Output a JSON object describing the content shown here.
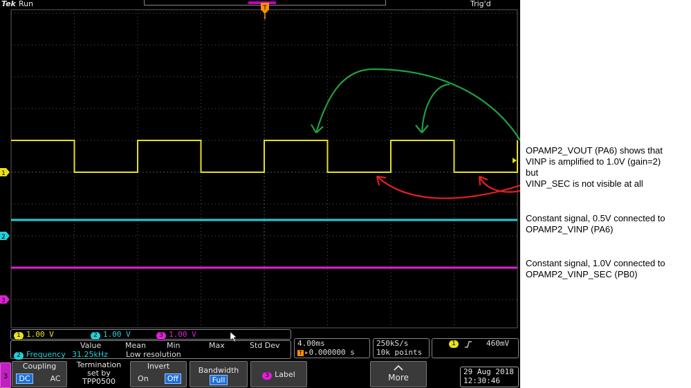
{
  "topbar": {
    "logo": "Tek",
    "run_state": "Run",
    "trigger_state": "Trig'd"
  },
  "colors": {
    "ch1": "#e8e020",
    "ch2": "#20d0d8",
    "ch3": "#e020d8",
    "arrow_green": "#20a040",
    "arrow_red": "#e02020",
    "grid": "#5a5a5a",
    "accent_blue": "#1e6fd6",
    "trigger_marker": "#ff9000"
  },
  "channels": [
    {
      "number": "1",
      "scale": "1.00 V"
    },
    {
      "number": "2",
      "scale": "1.00 V"
    },
    {
      "number": "3",
      "scale": "1.00 V"
    }
  ],
  "traces": {
    "ch1": {
      "shape": "square",
      "high_div": 1.0,
      "low_div": 0.0,
      "period_div": 2.0,
      "start_high": true,
      "edges_div": [
        1.0,
        2.0,
        3.0,
        4.0,
        5.0,
        6.0,
        7.0,
        8.0
      ]
    },
    "ch2": {
      "shape": "dc",
      "level_div": -1.5
    },
    "ch3": {
      "shape": "dc",
      "level_div": -3.0
    }
  },
  "measurement": {
    "headers": [
      "Value",
      "Mean",
      "Min",
      "Max",
      "Std Dev"
    ],
    "channel": "2",
    "name": "Frequency",
    "value": "31.25kHz",
    "note": "Low resolution"
  },
  "timebase": {
    "scale": "4.00ms",
    "position": "0.000000 s"
  },
  "acquisition": {
    "rate": "250kS/s",
    "record": "10k points"
  },
  "trigger": {
    "channel": "1",
    "slope_icon": "rising-edge-icon",
    "level": "460mV"
  },
  "menu": {
    "channel_tab": "3",
    "coupling": {
      "label": "Coupling",
      "options": [
        "DC",
        "AC"
      ],
      "selected": "DC"
    },
    "termination": {
      "line1": "Termination",
      "line2": "set by",
      "line3": "TPP0500"
    },
    "invert": {
      "label": "Invert",
      "options": [
        "On",
        "Off"
      ],
      "selected": "Off"
    },
    "bandwidth": {
      "label": "Bandwidth",
      "value": "Full"
    },
    "label_button": {
      "channel": "3",
      "label": "Label"
    },
    "more": {
      "label": "More",
      "icon": "chevron-up-icon"
    }
  },
  "datetime": {
    "date": "29 Aug 2018",
    "time": "12:30:46"
  },
  "annotations": [
    {
      "lines": [
        "OPAMP2_VOUT (PA6) shows that",
        "VINP is amplified to 1.0V (gain=2)",
        "but",
        "VINP_SEC is not visible at all"
      ]
    },
    {
      "lines": [
        "Constant signal, 0.5V connected to",
        "OPAMP2_VINP (PA6)"
      ]
    },
    {
      "lines": [
        "Constant signal, 1.0V connected to",
        "OPAMP2_VINP_SEC (PB0)"
      ]
    }
  ]
}
